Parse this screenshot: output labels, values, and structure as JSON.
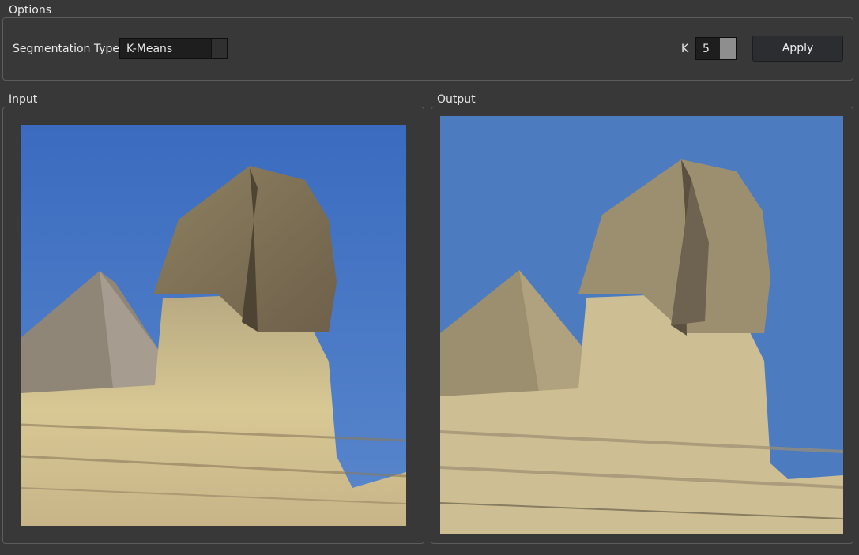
{
  "options": {
    "title": "Options",
    "segmentation_label": "Segmentation Type",
    "segmentation_value": "K-Means",
    "k_label": "K",
    "k_value": "5",
    "apply_label": "Apply"
  },
  "input": {
    "title": "Input"
  },
  "output": {
    "title": "Output"
  },
  "colors": {
    "window_bg": "#383838",
    "sky_input": "#3f72c4",
    "sky_output": "#4d7bc0",
    "stone_light": "#cdbf93",
    "stone_mid": "#9c8f70",
    "stone_dark": "#5c5140"
  }
}
